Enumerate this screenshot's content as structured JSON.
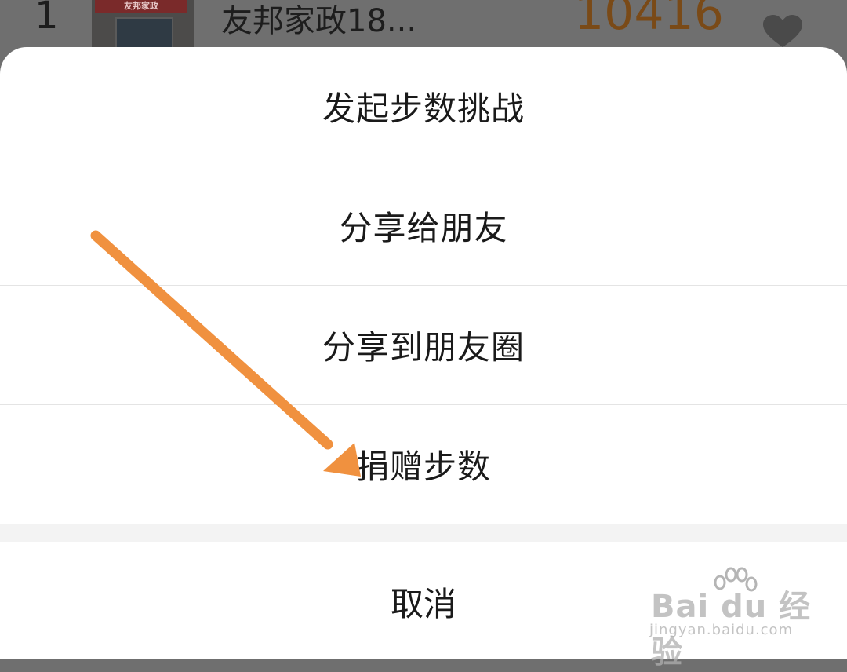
{
  "background_row": {
    "rank": "1",
    "thumbnail_sign": "友邦家政",
    "name": "友邦家政18...",
    "steps": "10416"
  },
  "sheet": {
    "options": [
      {
        "label": "发起步数挑战"
      },
      {
        "label": "分享给朋友"
      },
      {
        "label": "分享到朋友圈"
      },
      {
        "label": "捐赠步数"
      }
    ],
    "cancel_label": "取消"
  },
  "annotation": {
    "arrow_color": "#f0913f"
  },
  "watermark": {
    "logo": "Bai du 经验",
    "url": "jingyan.baidu.com"
  }
}
